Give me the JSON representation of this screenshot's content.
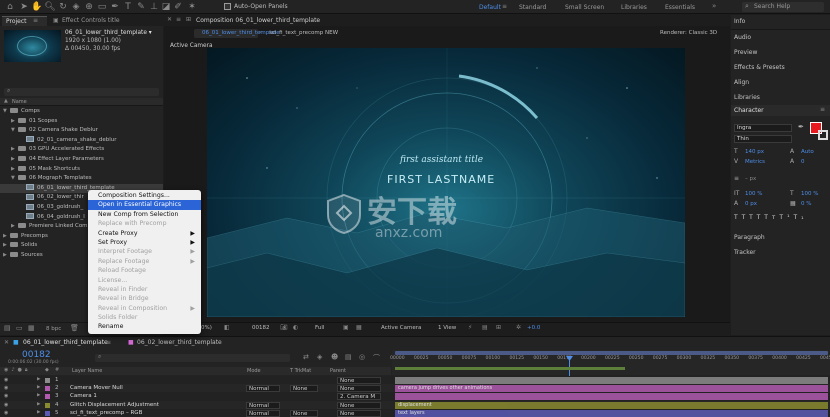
{
  "toolbar": {
    "auto_open_panels": "Auto-Open Panels"
  },
  "workspaces": [
    "Default",
    "Standard",
    "Small Screen",
    "Libraries",
    "Essentials"
  ],
  "search_help_placeholder": "Search Help",
  "project_panel": {
    "tab_project": "Project",
    "tab_effect_controls": "Effect Controls title",
    "selected_name": "06_01_lower_third_template ▾",
    "selected_meta1": "1920 x 1080 (1.00)",
    "selected_meta2": "Δ 00450, 30.00 fps",
    "search_placeholder": "⌕",
    "col_name": "Name",
    "tree": [
      {
        "label": "Comps",
        "kind": "folder",
        "indent": 0
      },
      {
        "label": "01 Scopes",
        "kind": "folder",
        "indent": 1
      },
      {
        "label": "02 Camera Shake Deblur",
        "kind": "folder",
        "indent": 1
      },
      {
        "label": "02_01_camera_shake_deblur",
        "kind": "comp",
        "indent": 2
      },
      {
        "label": "03 GPU Accelerated Effects",
        "kind": "folder",
        "indent": 1
      },
      {
        "label": "04 Effect Layer Parameters",
        "kind": "folder",
        "indent": 1
      },
      {
        "label": "05 Mask Shortcuts",
        "kind": "folder",
        "indent": 1
      },
      {
        "label": "06 Mograph Templates",
        "kind": "folder",
        "indent": 1
      },
      {
        "label": "06_01_lower_third_template",
        "kind": "comp",
        "indent": 2
      },
      {
        "label": "06_02_lower_thir",
        "kind": "comp",
        "indent": 2
      },
      {
        "label": "06_03_goldrush_",
        "kind": "comp",
        "indent": 2
      },
      {
        "label": "06_04_goldrush_l",
        "kind": "comp",
        "indent": 2
      },
      {
        "label": "Premiere Linked Comp",
        "kind": "folder",
        "indent": 1
      },
      {
        "label": "Precomps",
        "kind": "folder",
        "indent": 0
      },
      {
        "label": "Solids",
        "kind": "folder",
        "indent": 0
      },
      {
        "label": "Sources",
        "kind": "folder",
        "indent": 0
      }
    ],
    "bpc": "8 bpc"
  },
  "context_menu": [
    {
      "label": "Composition Settings...",
      "state": "normal",
      "arrow": ""
    },
    {
      "label": "Open in Essential Graphics",
      "state": "highlight",
      "arrow": ""
    },
    {
      "label": "New Comp from Selection",
      "state": "normal",
      "arrow": ""
    },
    {
      "label": "Replace with Precomp",
      "state": "disabled",
      "arrow": ""
    },
    {
      "label": "Create Proxy",
      "state": "normal",
      "arrow": "▶"
    },
    {
      "label": "Set Proxy",
      "state": "normal",
      "arrow": "▶"
    },
    {
      "label": "Interpret Footage",
      "state": "disabled",
      "arrow": "▶"
    },
    {
      "label": "Replace Footage",
      "state": "disabled",
      "arrow": "▶"
    },
    {
      "label": "Reload Footage",
      "state": "disabled",
      "arrow": ""
    },
    {
      "label": "License...",
      "state": "disabled",
      "arrow": ""
    },
    {
      "label": "Reveal in Finder",
      "state": "disabled",
      "arrow": ""
    },
    {
      "label": "Reveal in Bridge",
      "state": "disabled",
      "arrow": ""
    },
    {
      "label": "Reveal in Composition",
      "state": "disabled",
      "arrow": "▶"
    },
    {
      "label": "Solids Folder",
      "state": "disabled",
      "arrow": ""
    },
    {
      "label": "Rename",
      "state": "normal",
      "arrow": ""
    }
  ],
  "composition": {
    "panel_label": "Composition 06_01_lower_third_template",
    "tab1": "06_01_lower_third_template",
    "tab2": "sci_fi_text_precomp NEW",
    "renderer": "Renderer:  Classic 3D",
    "active_camera": "Active Camera",
    "subtitle": "first assistant title",
    "name": "FIRST LASTNAME",
    "footer": {
      "zoom": "0%)",
      "timecode": "00182",
      "quality": "Full",
      "camera": "Active Camera",
      "view": "1 View",
      "exposure": "+0.0"
    }
  },
  "watermark": {
    "cn": "安下载",
    "en": "anxz.com"
  },
  "right_panel": {
    "items": [
      "Info",
      "Audio",
      "Preview",
      "Effects & Presets",
      "Align",
      "Libraries"
    ],
    "character_title": "Character",
    "font": "Ingra",
    "style": "Thin",
    "size": "140 px",
    "leading": "Auto",
    "kerning": "Metrics",
    "tracking": "0",
    "stroke": "– px",
    "vscale": "100 %",
    "hscale": "100 %",
    "baseline": "0 px",
    "tsume": "0 %",
    "paragraph": "Paragraph",
    "tracker": "Tracker"
  },
  "timeline": {
    "tab1": "06_01_lower_third_template",
    "tab2": "06_02_lower_third_template",
    "timecode": "00182",
    "timecode_sub": "0:00:06:02 (30.00 fps)",
    "search_placeholder": "⌕",
    "col_layer_name": "Layer Name",
    "col_mode": "Mode",
    "col_trkmat": "T TrkMat",
    "col_parent": "Parent",
    "ruler": [
      "00000",
      "00025",
      "00050",
      "00075",
      "00100",
      "00125",
      "00150",
      "00175",
      "00200",
      "00225",
      "00250",
      "00275",
      "00300",
      "00325",
      "00350",
      "00375",
      "00400",
      "00425",
      "00450"
    ],
    "layers": [
      {
        "num": "1",
        "name": "",
        "mode": "",
        "trk": "",
        "parent": "None",
        "bar": "",
        "color": "#8c8c8c"
      },
      {
        "num": "2",
        "name": "Camera Mover Null",
        "mode": "Normal",
        "trk": "None",
        "parent": "None",
        "bar": "camera jump drives other animations",
        "color": "#b15ab0"
      },
      {
        "num": "3",
        "name": "Camera 1",
        "mode": "",
        "trk": "",
        "parent": "2. Camera M",
        "bar": "",
        "color": "#b15ab0"
      },
      {
        "num": "4",
        "name": "Glitch Displacement Adjustment",
        "mode": "Normal",
        "trk": "",
        "parent": "None",
        "bar": "displacement",
        "color": "#8a8a30"
      },
      {
        "num": "5",
        "name": "sci_fi_text_precomp – RGB",
        "mode": "Normal",
        "trk": "None",
        "parent": "None",
        "bar": "text layers",
        "color": "#5a5ab5"
      }
    ]
  }
}
